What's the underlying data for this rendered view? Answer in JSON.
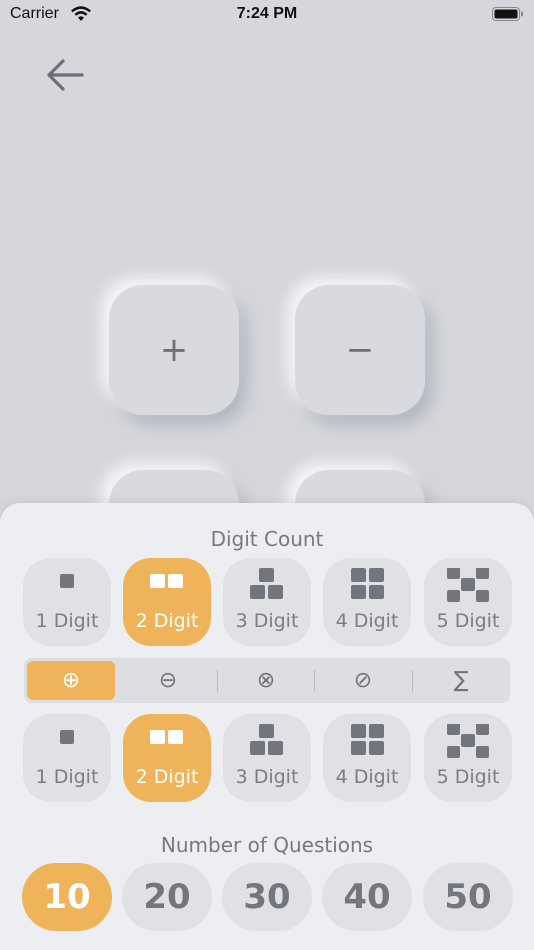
{
  "status_bar": {
    "carrier": "Carrier",
    "time": "7:24 PM"
  },
  "operations": {
    "add_symbol": "+",
    "subtract_symbol": "−"
  },
  "digit_count": {
    "title": "Digit Count",
    "options": [
      "1 Digit",
      "2 Digit",
      "3 Digit",
      "4 Digit",
      "5 Digit"
    ],
    "selected": "2 Digit"
  },
  "operation_tabs": {
    "items": [
      "⊕",
      "⊖",
      "⊗",
      "⊘",
      "∑"
    ],
    "selected": "⊕",
    "icons": [
      "plus-circle-icon",
      "minus-circle-icon",
      "times-circle-icon",
      "divide-circle-icon",
      "sigma-icon"
    ]
  },
  "second_digit_count": {
    "options": [
      "1 Digit",
      "2 Digit",
      "3 Digit",
      "4 Digit",
      "5 Digit"
    ],
    "selected": "2 Digit"
  },
  "questions": {
    "title": "Number of Questions",
    "options": [
      "10",
      "20",
      "30",
      "40",
      "50"
    ],
    "selected": "10"
  },
  "colors": {
    "accent": "#efb35a",
    "background": "#d5d7dc",
    "sheet": "#eceef1",
    "text": "#767983"
  }
}
